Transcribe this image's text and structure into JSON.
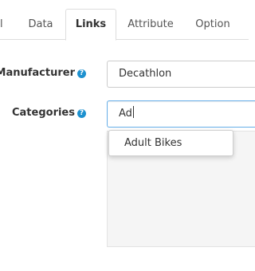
{
  "tabs": [
    {
      "label": "l"
    },
    {
      "label": "Data"
    },
    {
      "label": "Links"
    },
    {
      "label": "Attribute"
    },
    {
      "label": "Option"
    }
  ],
  "form": {
    "manufacturer": {
      "label": "Manufacturer",
      "value": "Decathlon"
    },
    "categories": {
      "label": "Categories",
      "value": "Ad"
    }
  },
  "help_glyph": "?",
  "autocomplete": {
    "items": [
      "Adult Bikes"
    ]
  },
  "colors": {
    "help": "#1e91cf",
    "focus_border": "#66afe9",
    "well": "#f5f5f5"
  }
}
